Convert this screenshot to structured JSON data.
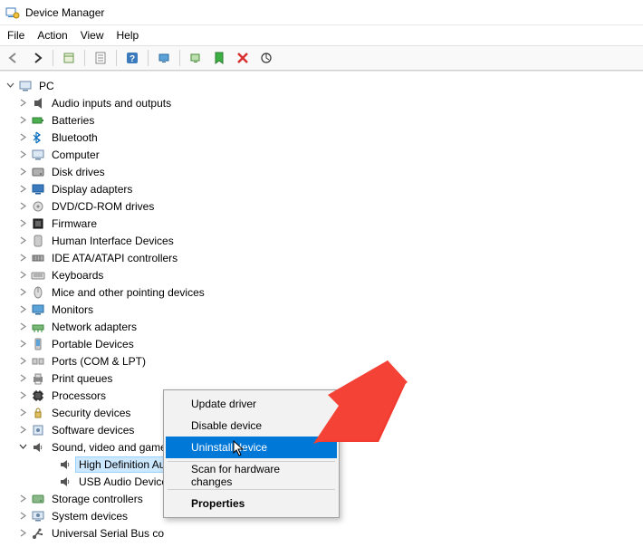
{
  "window": {
    "title": "Device Manager"
  },
  "menubar": {
    "file": "File",
    "action": "Action",
    "view": "View",
    "help": "Help"
  },
  "toolbar_icons": {
    "back": "back-arrow-icon",
    "forward": "forward-arrow-icon",
    "show_hidden": "show-hidden-icon",
    "properties": "properties-icon",
    "help": "help-icon",
    "refresh": "refresh-icon",
    "monitor": "monitor-icon",
    "install": "install-icon",
    "remove": "remove-icon",
    "scan": "scan-icon"
  },
  "tree": {
    "root": "PC",
    "categories": [
      {
        "label": "Audio inputs and outputs",
        "icon": "audio"
      },
      {
        "label": "Batteries",
        "icon": "battery"
      },
      {
        "label": "Bluetooth",
        "icon": "bluetooth"
      },
      {
        "label": "Computer",
        "icon": "computer"
      },
      {
        "label": "Disk drives",
        "icon": "disk"
      },
      {
        "label": "Display adapters",
        "icon": "display"
      },
      {
        "label": "DVD/CD-ROM drives",
        "icon": "dvd"
      },
      {
        "label": "Firmware",
        "icon": "firmware"
      },
      {
        "label": "Human Interface Devices",
        "icon": "hid"
      },
      {
        "label": "IDE ATA/ATAPI controllers",
        "icon": "ide"
      },
      {
        "label": "Keyboards",
        "icon": "keyboard"
      },
      {
        "label": "Mice and other pointing devices",
        "icon": "mouse"
      },
      {
        "label": "Monitors",
        "icon": "monitor"
      },
      {
        "label": "Network adapters",
        "icon": "network"
      },
      {
        "label": "Portable Devices",
        "icon": "portable"
      },
      {
        "label": "Ports (COM & LPT)",
        "icon": "ports"
      },
      {
        "label": "Print queues",
        "icon": "print"
      },
      {
        "label": "Processors",
        "icon": "processor"
      },
      {
        "label": "Security devices",
        "icon": "security"
      },
      {
        "label": "Software devices",
        "icon": "software"
      },
      {
        "label": "Sound, video and game controllers",
        "icon": "sound",
        "expanded": true,
        "children": [
          {
            "label": "High Definition Aud",
            "icon": "sound",
            "selected": true,
            "truncated": true
          },
          {
            "label": "USB Audio Device",
            "icon": "sound"
          }
        ]
      },
      {
        "label": "Storage controllers",
        "icon": "storage"
      },
      {
        "label": "System devices",
        "icon": "system"
      },
      {
        "label": "Universal Serial Bus co",
        "icon": "usb",
        "truncated": true
      }
    ]
  },
  "contextmenu": {
    "items": [
      {
        "label": "Update driver",
        "type": "item"
      },
      {
        "label": "Disable device",
        "type": "item"
      },
      {
        "label": "Uninstall device",
        "type": "item",
        "highlighted": true
      },
      {
        "type": "separator"
      },
      {
        "label": "Scan for hardware changes",
        "type": "item"
      },
      {
        "type": "separator"
      },
      {
        "label": "Properties",
        "type": "item",
        "bold": true
      }
    ]
  }
}
